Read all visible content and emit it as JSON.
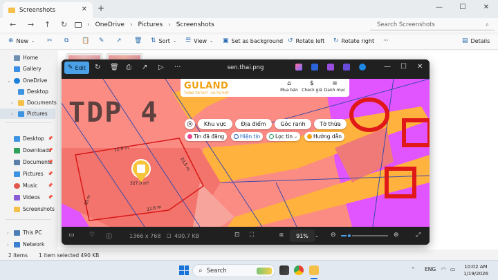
{
  "explorer": {
    "tab_title": "Screenshots",
    "breadcrumbs": [
      "OneDrive",
      "Pictures",
      "Screenshots"
    ],
    "search_placeholder": "Search Screenshots",
    "commands": {
      "new": "New",
      "sort": "Sort",
      "view": "View",
      "set_background": "Set as background",
      "rotate_left": "Rotate left",
      "rotate_right": "Rotate right",
      "more": "···",
      "details": "Details"
    },
    "sidebar": {
      "home": "Home",
      "gallery": "Gallery",
      "onedrive": "OneDrive",
      "od_desktop": "Desktop",
      "od_documents": "Documents",
      "od_pictures": "Pictures",
      "desktop": "Desktop",
      "downloads": "Downloads",
      "documents": "Documents",
      "pictures": "Pictures",
      "music": "Music",
      "videos": "Videos",
      "screenshots": "Screenshots",
      "this_pc": "This PC",
      "network": "Network"
    },
    "status": {
      "items": "2 items",
      "selected": "1 item selected  490 KB"
    }
  },
  "viewer": {
    "edit_label": "Edit",
    "filename": "sen.thai.png",
    "dimensions": "1366 x 768",
    "filesize": "490.7 KB",
    "zoom": "91%",
    "zoom_level": 0.18
  },
  "map": {
    "brand": "GULAND",
    "brand_tagline": "THÔNG TIN THẬT - GIÁ TRỊ THẬT",
    "actions": [
      "Mua bán",
      "Check giá",
      "Danh mục"
    ],
    "filters_row1": [
      "Khu vực",
      "Địa điểm",
      "Góc ranh",
      "Tờ thửa"
    ],
    "filters_row2": [
      "Tin đã đăng",
      "Hiện tin",
      "Lọc tin",
      "Hướng dẫn"
    ],
    "overlay_text": "TDP 4",
    "marker_label": "327.0 m²",
    "dim_labels": [
      "12.9 m",
      "23.5 m",
      "16 m",
      "22.8 m"
    ]
  },
  "taskbar": {
    "search_label": "Search",
    "lang": "ENG",
    "time": "10:02 AM",
    "date": "1/19/2026"
  },
  "colors": {
    "accent": "#4aa1e8",
    "map_pink": "#fb8c84",
    "map_orange": "#ffb23d",
    "map_magenta": "#e055ff",
    "map_red": "#e01818",
    "brand": "#f0a010"
  }
}
